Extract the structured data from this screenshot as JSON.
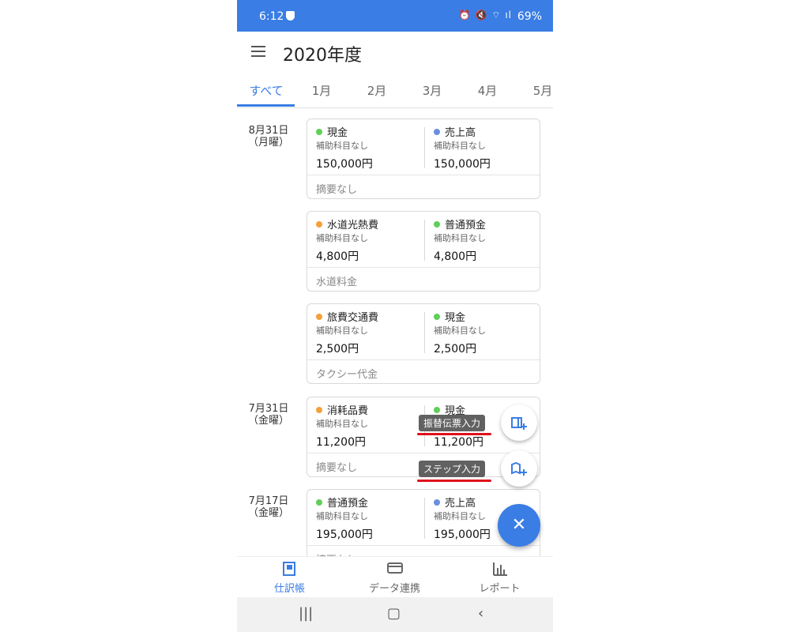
{
  "status": {
    "time": "6:12",
    "icons": "⏰ 🔇 ⌔ ıl",
    "battery": "69%"
  },
  "header": {
    "title": "2020年度"
  },
  "tabs": [
    "すべて",
    "1月",
    "2月",
    "3月",
    "4月",
    "5月"
  ],
  "groups": [
    {
      "date": "8月31日",
      "weekday": "（月曜）"
    },
    {
      "date": "7月31日",
      "weekday": "（金曜）"
    },
    {
      "date": "7月17日",
      "weekday": "（金曜）"
    }
  ],
  "entries": [
    {
      "debit": {
        "name": "現金",
        "sub": "補助科目なし",
        "amount": "150,000円"
      },
      "credit": {
        "name": "売上高",
        "sub": "補助科目なし",
        "amount": "150,000円"
      },
      "memo": "摘要なし"
    },
    {
      "debit": {
        "name": "水道光熱費",
        "sub": "補助科目なし",
        "amount": "4,800円"
      },
      "credit": {
        "name": "普通預金",
        "sub": "補助科目なし",
        "amount": "4,800円"
      },
      "memo": "水道料金"
    },
    {
      "debit": {
        "name": "旅費交通費",
        "sub": "補助科目なし",
        "amount": "2,500円"
      },
      "credit": {
        "name": "現金",
        "sub": "補助科目なし",
        "amount": "2,500円"
      },
      "memo": "タクシー代金"
    },
    {
      "debit": {
        "name": "消耗品費",
        "sub": "補助科目なし",
        "amount": "11,200円"
      },
      "credit": {
        "name": "現金",
        "sub": "補助科目なし",
        "amount": "11,200円"
      },
      "memo": "摘要なし"
    },
    {
      "debit": {
        "name": "普通預金",
        "sub": "補助科目なし",
        "amount": "195,000円"
      },
      "credit": {
        "name": "売上高",
        "sub": "補助科目なし",
        "amount": "195,000円"
      },
      "memo": "摘要なし"
    }
  ],
  "fab": {
    "transfer_label": "振替伝票入力",
    "step_label": "ステップ入力",
    "close_icon": "close-icon"
  },
  "bottom_nav": [
    "仕訳帳",
    "データ連携",
    "レポート"
  ],
  "colors": {
    "accent": "#3a7de4",
    "dot_green": "#5fcf58",
    "dot_blue": "#6b8fde",
    "dot_orange": "#f5a03a",
    "highlight_red": "#e0101a"
  }
}
